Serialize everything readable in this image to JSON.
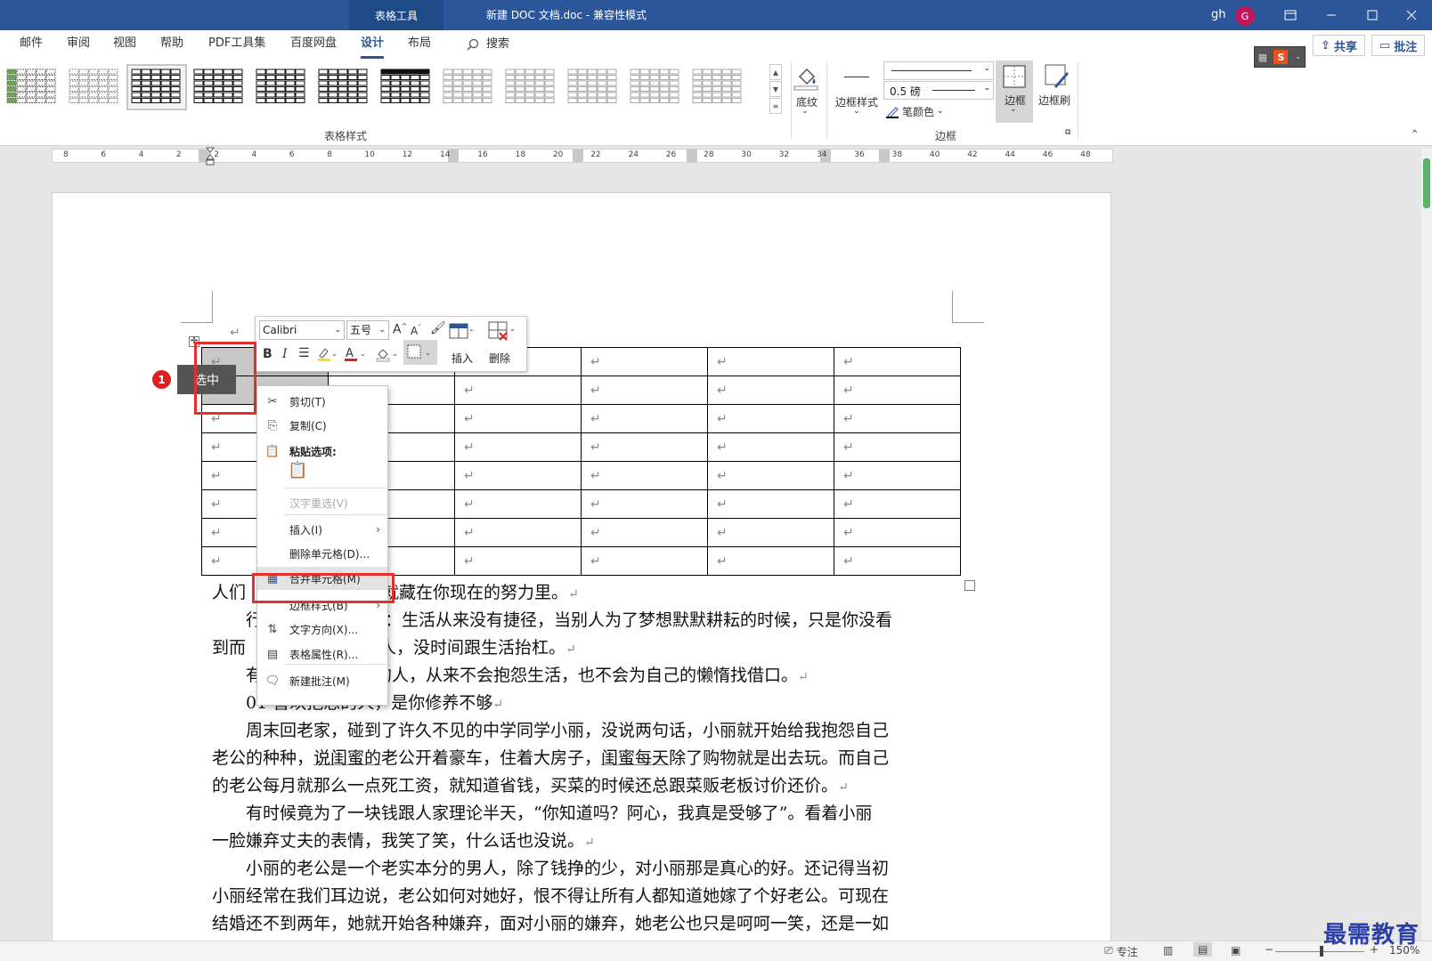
{
  "titlebar": {
    "context_tab": "表格工具",
    "doc_title": "新建 DOC 文档.doc  -  兼容性模式",
    "user": "gh",
    "avatar": "G"
  },
  "menu": {
    "tabs": [
      "邮件",
      "审阅",
      "视图",
      "帮助",
      "PDF工具集",
      "百度网盘",
      "设计",
      "布局"
    ],
    "active_tab": "设计",
    "search": "搜索",
    "share": "共享",
    "comment": "批注"
  },
  "ribbon": {
    "table_styles_label": "表格样式",
    "shading": "底纹",
    "border_styles": "边框样式",
    "pen_weight": "0.5 磅",
    "pen_color": "笔颜色",
    "borders": "边框",
    "border_painter": "边框刷",
    "borders_group_label": "边框"
  },
  "ruler": {
    "labels": [
      "8",
      "6",
      "4",
      "2",
      "2",
      "4",
      "6",
      "8",
      "10",
      "12",
      "14",
      "16",
      "18",
      "20",
      "22",
      "24",
      "26",
      "28",
      "30",
      "32",
      "34",
      "36",
      "38",
      "40",
      "42",
      "44",
      "46",
      "48"
    ]
  },
  "table": {
    "rows": 8,
    "cols": 6,
    "cell_mark": "↵"
  },
  "annotation": {
    "step": "1",
    "label": "选中"
  },
  "mini_toolbar": {
    "font": "Calibri",
    "size": "五号",
    "bold": "B",
    "italic": "I",
    "insert": "插入",
    "delete": "删除"
  },
  "context_menu": {
    "items": [
      {
        "icon": "scissors-icon",
        "label": "剪切(T)"
      },
      {
        "icon": "copy-icon",
        "label": "复制(C)"
      },
      {
        "icon": "paste-icon",
        "label": "粘贴选项:"
      },
      {
        "label": "汉字重选(V)",
        "disabled": true
      },
      {
        "label": "插入(I)",
        "submenu": true
      },
      {
        "label": "删除单元格(D)..."
      },
      {
        "icon": "merge-cells-icon",
        "label": "合并单元格(M)",
        "highlighted": true
      },
      {
        "label": "边框样式(B)",
        "submenu": true
      },
      {
        "icon": "text-direction-icon",
        "label": "文字方向(X)..."
      },
      {
        "icon": "table-properties-icon",
        "label": "表格属性(R)..."
      },
      {
        "icon": "new-comment-icon",
        "label": "新建批注(M)"
      }
    ]
  },
  "body": {
    "line1a": "人们",
    "line1b": "模样，就藏在你现在的努力里。",
    "line2a": "行",
    "line2b": "话：生活从来没有捷径，当别人为了梦想默默耕耘的时候，只是你没看",
    "line3a": "到而",
    "line3b": "人，没时间跟生活抬杠。",
    "line4a": "有",
    "line4b": "的人，从来不会抱怨生活，也不会为自己的懒惰找借口。",
    "line5": "01  喜欢抱怨的人，是你修养不够",
    "line6": "周末回老家，碰到了许久不见的中学同学小丽，没说两句话，小丽就开始给我抱怨自己",
    "line7a": "老公的种种，",
    "line7b": "说闺蜜的",
    "line7c": "老公开着豪车，住着大房子，",
    "line7d": "闺蜜每天",
    "line7e": "除了购物就是出去玩。而自己",
    "line8": "的老公每月就那么一点死工资，就知道省钱，买菜的时候还总跟菜贩老板讨价还价。",
    "line9": "有时候竟为了一块钱跟人家理论半天，“你知道吗？阿心，我真是受够了”。看着小丽",
    "line10": "一脸嫌弃丈夫的表情，我笑了笑，什么话也没说。",
    "line11": "小丽的老公是一个老实本分的男人，除了钱挣的少，对小丽那是真心的好。还记得当初",
    "line12": "小丽经常在我们耳边说，老公如何对她好，恨不得让所有人都知道她嫁了个好老公。可现在",
    "line13": "结婚还不到两年，她就开始各种嫌弃，面对小丽的嫌弃，她老公也只是呵呵一笑，还是一如",
    "return_mark": "↵"
  },
  "status": {
    "focus": "专注",
    "zoom": "150%"
  },
  "watermark": "最需教育"
}
